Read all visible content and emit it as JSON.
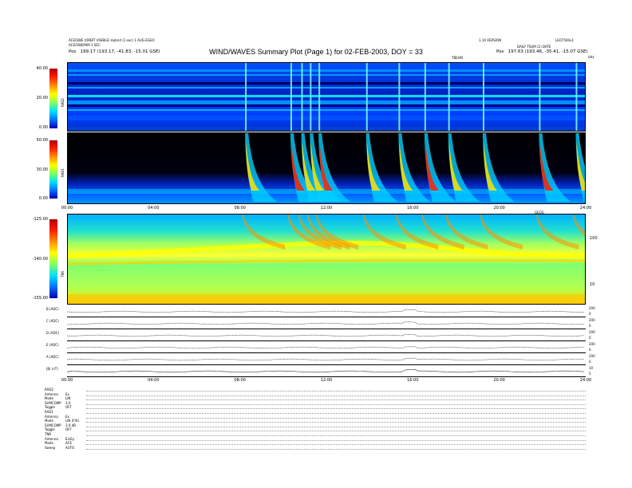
{
  "header": {
    "title": "WIND/WAVES Summary Plot (Page 1) for 02-FEB-2003, DOY = 33",
    "left_line1": "ACE/SWE (ORBIT VISIBLE) Hybrid (1-sec) 1 AUG-EGEO",
    "left_line2": "ACE/SWEPAM 3 SEC",
    "left_pos_label": "Pos",
    "left_pos_value": "199.17 (193.17, -41.83, -15.01 GSE)",
    "right_line1": "1.10 VERSION",
    "right_line2": "LEO7500v1",
    "right_line3": "DAILY TSUM (1) DATE",
    "right_pos_label": "Pos",
    "right_pos_value": "197.63 (193.46, -35.41, -15.07 GSE)",
    "khz": "kHz",
    "top_axis_label": "TBEAM"
  },
  "panels": {
    "rad2": {
      "name": "RAD2",
      "ticks": [
        "40.00",
        "20.00",
        "0.00"
      ]
    },
    "rad1": {
      "name": "RAD1",
      "ticks": [
        "50.00",
        "30.00",
        "0.00"
      ]
    },
    "tnr": {
      "name": "TNR",
      "ticks": [
        "-125.00",
        "-140.00",
        "-155.00"
      ],
      "right_ticks": [
        "100",
        "10"
      ],
      "right_label": "GEOG"
    }
  },
  "time_axis": {
    "ticks": [
      "00:00",
      "04:00",
      "08:00",
      "12:00",
      "16:00",
      "20:00",
      "24:00"
    ]
  },
  "timeseries": {
    "rows": [
      {
        "label": "B (ADC)",
        "r1": "200",
        "r2": "0"
      },
      {
        "label": "C (ADC)",
        "r1": "200",
        "r2": "0"
      },
      {
        "label": "D (ADC)",
        "r1": "200",
        "r2": "0"
      },
      {
        "label": "E (ADC)",
        "r1": "200",
        "r2": "0"
      },
      {
        "label": "A (ADC)",
        "r1": "200",
        "r2": "0"
      },
      {
        "label": "|B| (nT)",
        "r1": "10",
        "r2": "5"
      }
    ]
  },
  "footer": {
    "lines": [
      {
        "label": "RAD2",
        "value": ""
      },
      {
        "label": "Antenna",
        "value": "Ex"
      },
      {
        "label": "Mode",
        "value": "LIN"
      },
      {
        "label": "SUMCOMP",
        "value": "3.0"
      },
      {
        "label": "Toggle",
        "value": "OFF"
      },
      {
        "label": "RAD1",
        "value": ""
      },
      {
        "label": "Antenna",
        "value": "Ex"
      },
      {
        "label": "Mode",
        "value": "LIN (FIX)"
      },
      {
        "label": "SUMCOMP",
        "value": "3.0 dB"
      },
      {
        "label": "Toggle",
        "value": "OFF"
      },
      {
        "label": "TNR",
        "value": ""
      },
      {
        "label": "Antenna",
        "value": "Ex/Ey"
      },
      {
        "label": "Mode",
        "value": "ACE"
      },
      {
        "label": "Sweep",
        "value": "AUTO"
      }
    ]
  },
  "chart_data": {
    "type": "heatmap",
    "title": "WIND/WAVES Summary Plot (Page 1) for 02-FEB-2003, DOY = 33",
    "x_range_hours": [
      0,
      24
    ],
    "bursts_hours": [
      8.2,
      10.3,
      10.8,
      11.2,
      11.6,
      13.8,
      15.3,
      16.5,
      17.6,
      19.2,
      21.8,
      23.5
    ],
    "panels": [
      "RAD2",
      "RAD1",
      "TNR"
    ],
    "colorscale": [
      "#0000b0",
      "#0070ff",
      "#00e0ff",
      "#80ff60",
      "#ffff00",
      "#ff9000",
      "#ff2000",
      "#b00000"
    ]
  }
}
